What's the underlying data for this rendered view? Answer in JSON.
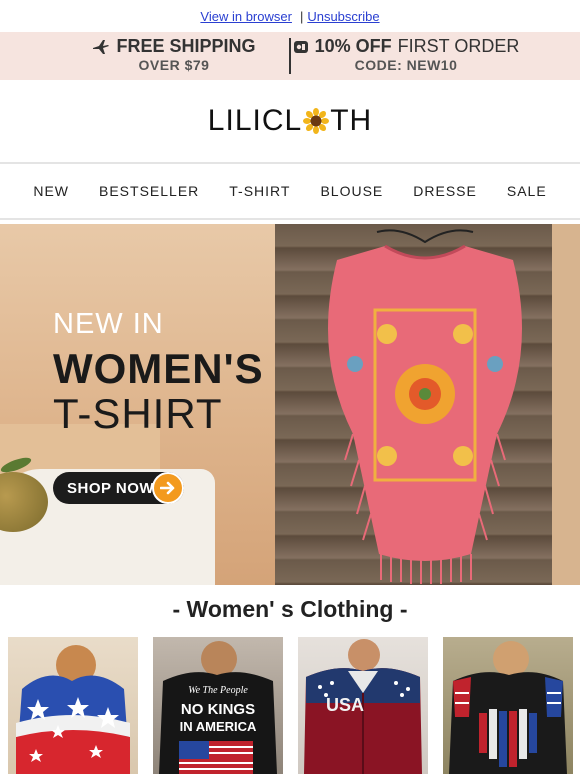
{
  "top_links": {
    "view_in_browser": "View in browser",
    "separator": "|",
    "unsubscribe": "Unsubscribe"
  },
  "promo": {
    "shipping_title": "FREE SHIPPING",
    "shipping_sub": "OVER $79",
    "discount_bold": "10% OFF",
    "discount_light": "FIRST ORDER",
    "discount_code": "CODE: NEW10",
    "icons": [
      "airplane-icon",
      "coupon-icon"
    ]
  },
  "brand": {
    "logo_left": "LILICL",
    "logo_right": "TH",
    "logo_icon": "sunflower-icon"
  },
  "nav": {
    "items": [
      "NEW",
      "BESTSELLER",
      "T-SHIRT",
      "BLOUSE",
      "DRESSE",
      "SALE"
    ]
  },
  "hero": {
    "line1": "NEW IN",
    "line2": "WOMEN'S",
    "line3": "T-SHIRT",
    "cta": "SHOP NOW",
    "cta_icon": "arrow-right-icon",
    "accent": "#f39a1e"
  },
  "section": {
    "title": "- Women' s Clothing -"
  },
  "products": [
    {
      "image": "tie-dye-star-tee"
    },
    {
      "image": "black-graphic-tee",
      "print_top": "We The People",
      "print_mid": "NO KINGS",
      "print_bot": "IN AMERICA"
    },
    {
      "image": "burgundy-shirt",
      "print": "USA"
    },
    {
      "image": "black-heart-flag-tee"
    }
  ]
}
